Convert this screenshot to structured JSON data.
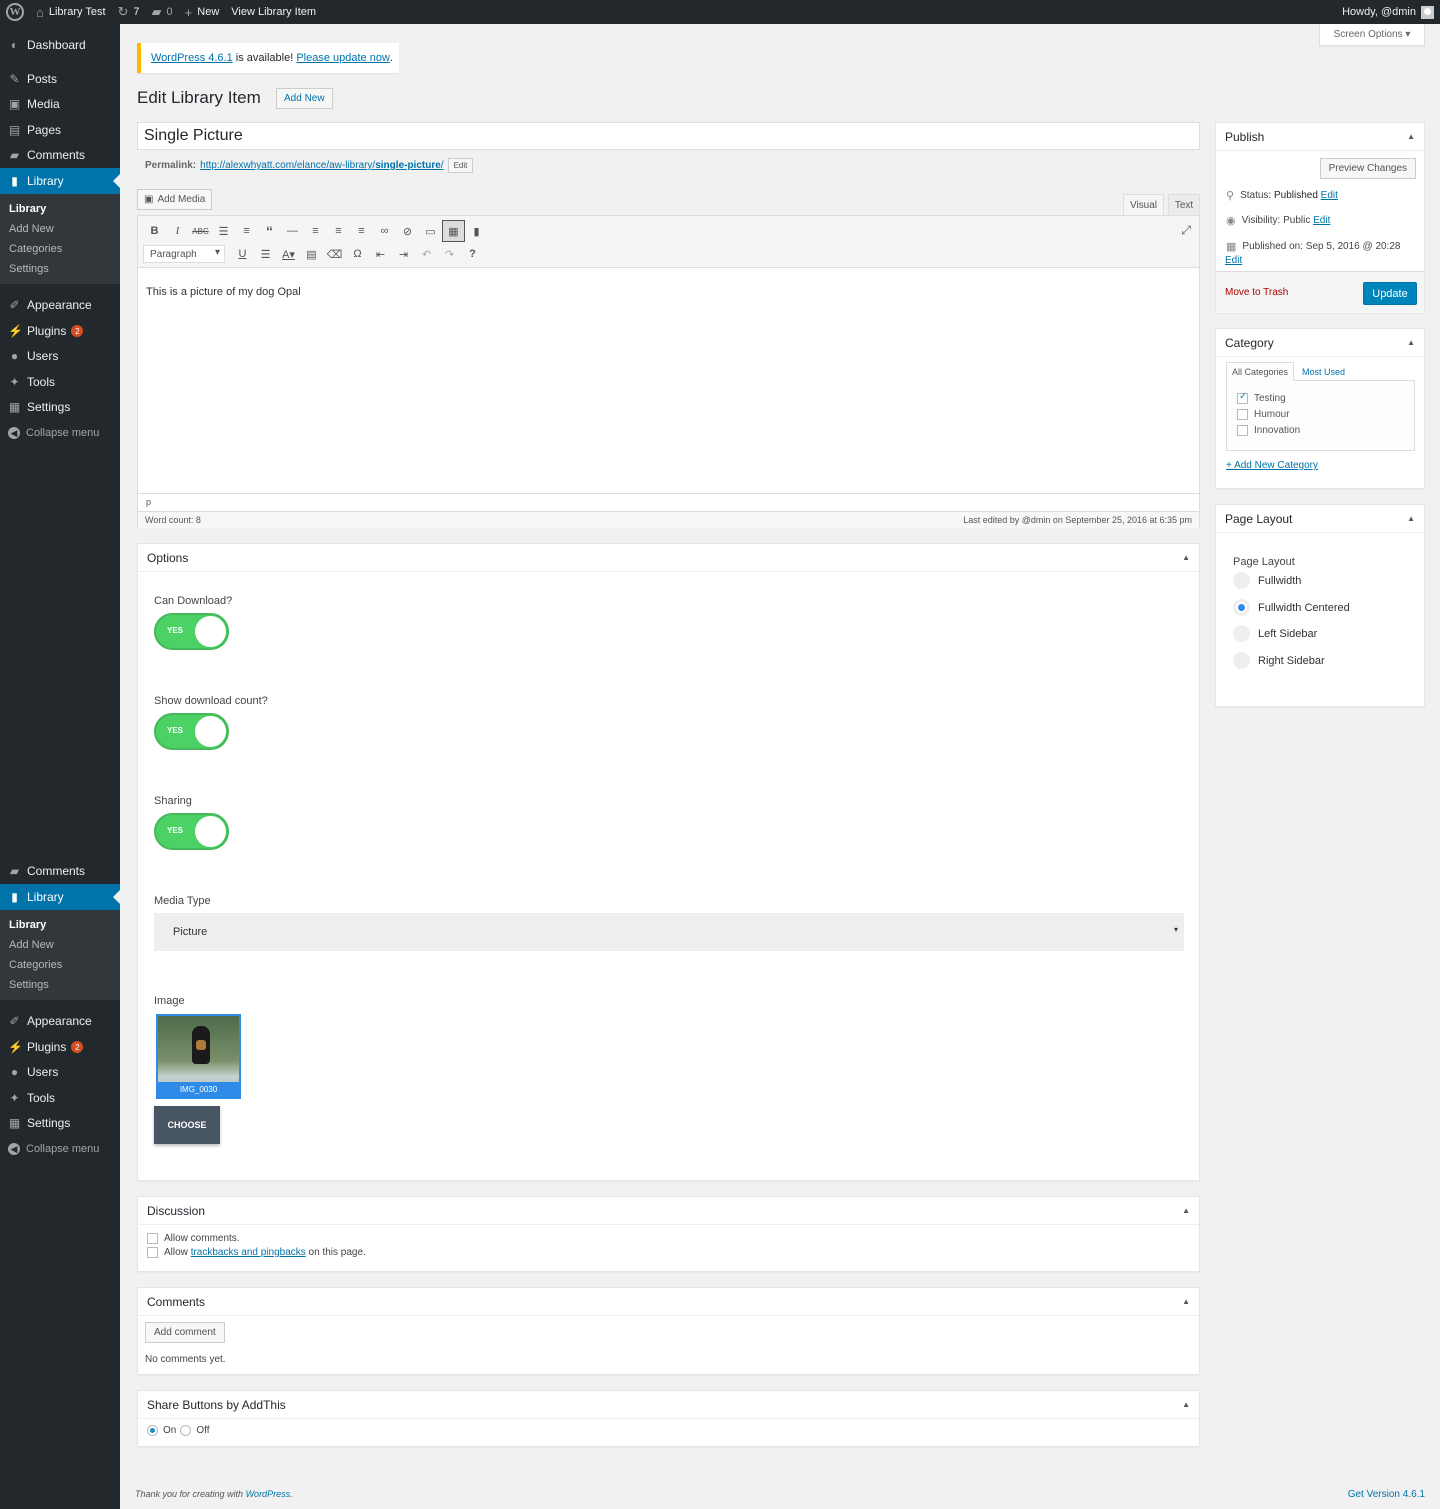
{
  "adminbar": {
    "site_name": "Library Test",
    "updates_count": "7",
    "comments_count": "0",
    "new_label": "New",
    "view_label": "View Library Item",
    "howdy": "Howdy, @dmin"
  },
  "sidebar": {
    "items": [
      {
        "label": "Dashboard"
      },
      {
        "label": "Posts"
      },
      {
        "label": "Media"
      },
      {
        "label": "Pages"
      },
      {
        "label": "Comments"
      },
      {
        "label": "Library"
      },
      {
        "label": "Appearance"
      },
      {
        "label": "Plugins",
        "badge": "2"
      },
      {
        "label": "Users"
      },
      {
        "label": "Tools"
      },
      {
        "label": "Settings"
      },
      {
        "label": "Collapse menu"
      }
    ],
    "library_submenu": [
      "Library",
      "Add New",
      "Categories",
      "Settings"
    ],
    "repeat_items": [
      {
        "label": "Comments"
      },
      {
        "label": "Library"
      },
      {
        "label": "Appearance"
      },
      {
        "label": "Plugins",
        "badge": "2"
      },
      {
        "label": "Users"
      },
      {
        "label": "Tools"
      },
      {
        "label": "Settings"
      },
      {
        "label": "Collapse menu"
      }
    ]
  },
  "screen_options": "Screen Options",
  "notice": {
    "version_link": "WordPress 4.6.1",
    "middle": " is available! ",
    "update_link": "Please update now",
    "end": "."
  },
  "page": {
    "title": "Edit Library Item",
    "add_new": "Add New",
    "post_title": "Single Picture",
    "permalink_label": "Permalink:",
    "permalink_base": "http://alexwhyatt.com/elance/aw-library/",
    "permalink_slug": "single-picture",
    "permalink_end": "/",
    "permalink_edit": "Edit"
  },
  "editor": {
    "add_media": "Add Media",
    "tab_visual": "Visual",
    "tab_text": "Text",
    "format": "Paragraph",
    "content": "This is a picture of my dog Opal",
    "path": "p",
    "word_count": "Word count: 8",
    "last_edited": "Last edited by @dmin on September 25, 2016 at 6:35 pm"
  },
  "options": {
    "title": "Options",
    "can_download_label": "Can Download?",
    "show_count_label": "Show download count?",
    "sharing_label": "Sharing",
    "toggle_text": "YES",
    "media_type_label": "Media Type",
    "media_type_value": "Picture",
    "image_label": "Image",
    "image_caption": "IMG_0030",
    "choose": "CHOOSE"
  },
  "discussion": {
    "title": "Discussion",
    "allow_comments": "Allow comments.",
    "allow_pre": "Allow ",
    "allow_link": "trackbacks and pingbacks",
    "allow_post": " on this page."
  },
  "comments_box": {
    "title": "Comments",
    "add_comment": "Add comment",
    "none": "No comments yet."
  },
  "share": {
    "title": "Share Buttons by AddThis",
    "on": "On",
    "off": "Off"
  },
  "publish": {
    "title": "Publish",
    "preview": "Preview Changes",
    "status_label": "Status: ",
    "status_value": "Published",
    "visibility_label": "Visibility: ",
    "visibility_value": "Public",
    "published_label": "Published on: ",
    "published_value": "Sep 5, 2016 @ 20:28",
    "edit": "Edit",
    "trash": "Move to Trash",
    "update": "Update"
  },
  "category": {
    "title": "Category",
    "tab_all": "All Categories",
    "tab_most": "Most Used",
    "items": [
      {
        "label": "Testing",
        "checked": true
      },
      {
        "label": "Humour",
        "checked": false
      },
      {
        "label": "Innovation",
        "checked": false
      }
    ],
    "add_new": "+ Add New Category"
  },
  "page_layout": {
    "title": "Page Layout",
    "label": "Page Layout",
    "options": [
      "Fullwidth",
      "Fullwidth Centered",
      "Left Sidebar",
      "Right Sidebar"
    ],
    "selected": "Fullwidth Centered"
  },
  "footer": {
    "thanks": "Thank you for creating with ",
    "wp": "WordPress",
    "thanks_end": ".",
    "version": "Get Version 4.6.1"
  },
  "colors": {
    "accent": "#0073aa",
    "toggle_on": "#4cd264",
    "sidebar_bg": "#23282d"
  }
}
